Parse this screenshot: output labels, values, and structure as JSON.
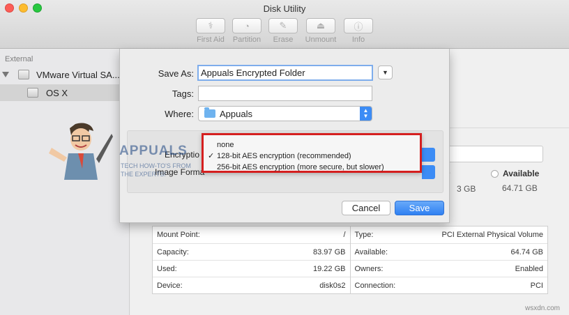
{
  "window": {
    "title": "Disk Utility"
  },
  "toolbar": {
    "items": [
      {
        "label": "First Aid",
        "icon": "stethoscope-icon"
      },
      {
        "label": "Partition",
        "icon": "pie-icon"
      },
      {
        "label": "Erase",
        "icon": "eraser-icon"
      },
      {
        "label": "Unmount",
        "icon": "eject-icon"
      },
      {
        "label": "Info",
        "icon": "info-icon"
      }
    ]
  },
  "sidebar": {
    "section": "External",
    "items": [
      {
        "label": "VMware Virtual SA..."
      },
      {
        "label": "OS X"
      }
    ]
  },
  "volume_summary": {
    "used_suffix": "er",
    "used_value_fragment": "3 GB",
    "available_label": "Available",
    "available_value": "64.71 GB"
  },
  "info_table": {
    "left": [
      {
        "label": "Mount Point:",
        "value": "/"
      },
      {
        "label": "Capacity:",
        "value": "83.97 GB"
      },
      {
        "label": "Used:",
        "value": "19.22 GB"
      },
      {
        "label": "Device:",
        "value": "disk0s2"
      }
    ],
    "right": [
      {
        "label": "Type:",
        "value": "PCI External Physical Volume"
      },
      {
        "label": "Available:",
        "value": "64.74 GB"
      },
      {
        "label": "Owners:",
        "value": "Enabled"
      },
      {
        "label": "Connection:",
        "value": "PCI"
      }
    ]
  },
  "save_dialog": {
    "save_as_label": "Save As:",
    "save_as_value": "Appuals Encrypted Folder",
    "tags_label": "Tags:",
    "tags_value": "",
    "where_label": "Where:",
    "where_value": "Appuals",
    "encryption_label": "Encryptio",
    "image_format_label": "Image Forma",
    "cancel_label": "Cancel",
    "save_label": "Save"
  },
  "encryption_menu": {
    "items": [
      {
        "label": "none",
        "check": ""
      },
      {
        "label": "128-bit AES encryption (recommended)",
        "check": "✓"
      },
      {
        "label": "256-bit AES encryption (more secure, but slower)",
        "check": ""
      }
    ],
    "highlight_color": "#d51f1f"
  },
  "watermark": {
    "brand": "APPUALS",
    "tagline_1": "TECH HOW-TO'S FROM",
    "tagline_2": "THE EXPERTS!"
  },
  "site": "wsxdn.com",
  "colors": {
    "accent": "#3c8cf5",
    "focus_ring": "#7eadec"
  }
}
